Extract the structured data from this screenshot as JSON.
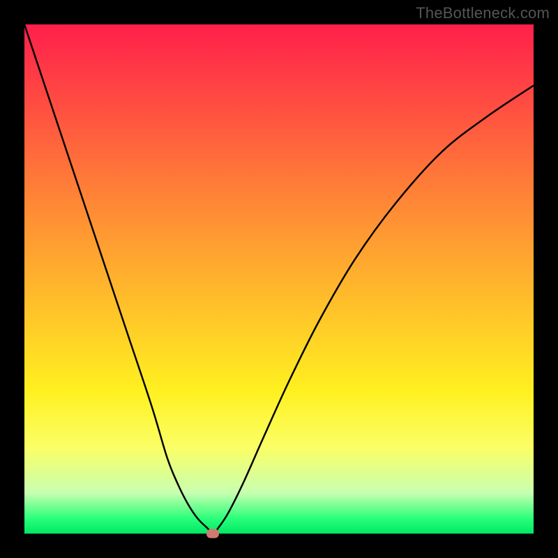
{
  "watermark": "TheBottleneck.com",
  "colors": {
    "frame": "#000000",
    "gradient_top": "#ff1f4b",
    "gradient_bottom": "#00e865",
    "curve_stroke": "#000000",
    "marker_fill": "#cf7a70"
  },
  "chart_data": {
    "type": "line",
    "title": "",
    "xlabel": "",
    "ylabel": "",
    "xlim": [
      0,
      100
    ],
    "ylim": [
      0,
      100
    ],
    "background": "vertical rainbow gradient (red→orange→yellow→green)",
    "series": [
      {
        "name": "bottleneck-curve",
        "x": [
          0,
          5,
          10,
          15,
          20,
          25,
          28,
          30,
          32,
          34,
          36,
          36.5,
          37,
          37.5,
          38,
          40,
          43,
          47,
          52,
          58,
          65,
          73,
          82,
          91,
          100
        ],
        "y": [
          100,
          85,
          70,
          55,
          40,
          25,
          15,
          10,
          6,
          3,
          1,
          0.4,
          0,
          0.4,
          1,
          4,
          10,
          19,
          30,
          42,
          54,
          65,
          75,
          82,
          88
        ]
      }
    ],
    "annotations": [
      {
        "name": "minimum-marker",
        "x": 37,
        "y": 0,
        "shape": "rounded-rect",
        "color": "#cf7a70"
      }
    ],
    "grid": false,
    "legend": false
  }
}
